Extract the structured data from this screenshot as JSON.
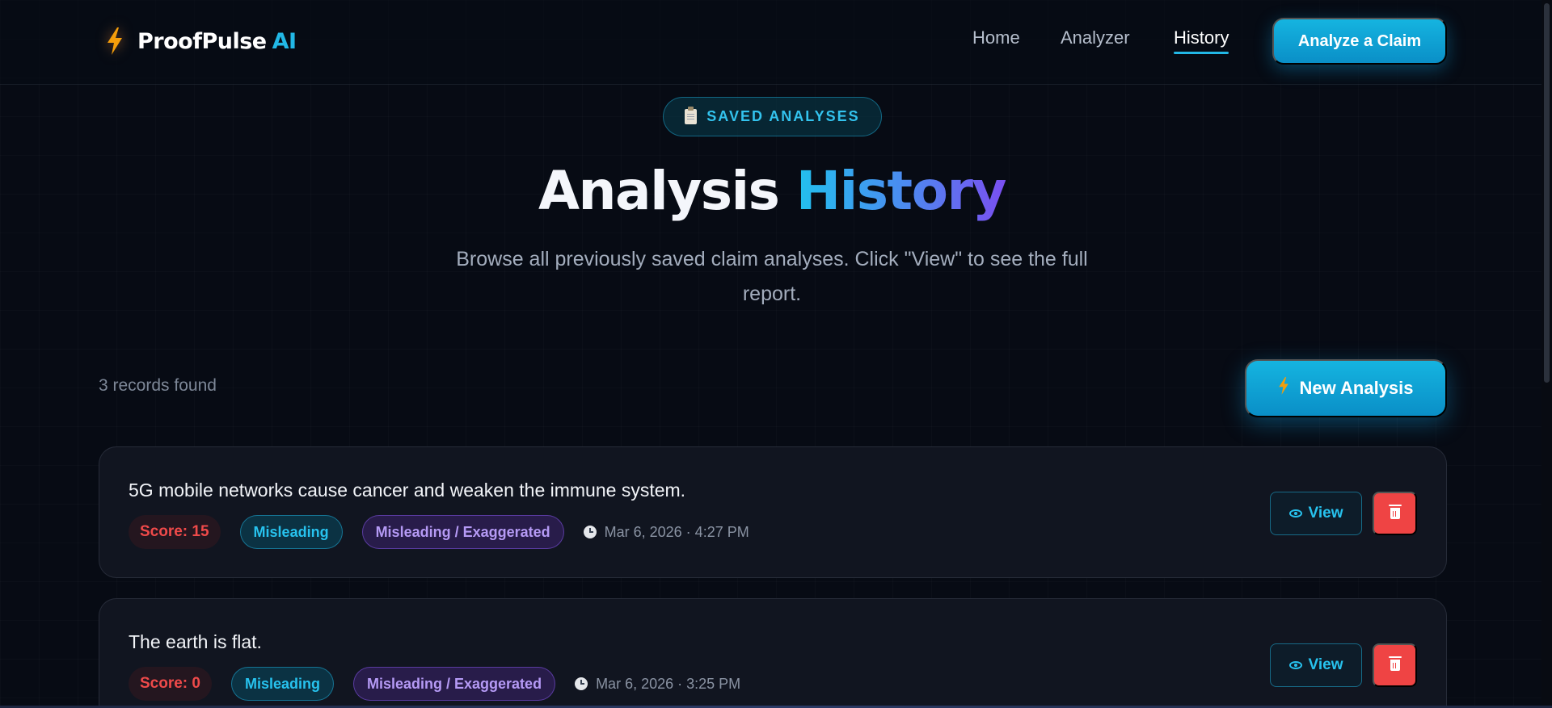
{
  "nav": {
    "brand_name": "ProofPulse",
    "brand_ai": "AI",
    "links": [
      "Home",
      "Analyzer",
      "History"
    ],
    "active_link": "History",
    "cta_label": "Analyze a Claim"
  },
  "hero": {
    "pill_label": "SAVED ANALYSES",
    "title_main": "Analysis",
    "title_accent": "History",
    "subtitle": "Browse all previously saved claim analyses. Click \"View\" to see the full report."
  },
  "toolbar": {
    "records_count": "3 records found",
    "new_analysis_label": "New Analysis"
  },
  "records": [
    {
      "claim": "5G mobile networks cause cancer and weaken the immune system.",
      "score": "Score: 15",
      "verdict": "Misleading",
      "category": "Misleading / Exaggerated",
      "timestamp": "Mar 6, 2026 · 4:27 PM",
      "view_label": "View"
    },
    {
      "claim": "The earth is flat.",
      "score": "Score: 0",
      "verdict": "Misleading",
      "category": "Misleading / Exaggerated",
      "timestamp": "Mar 6, 2026 · 3:25 PM",
      "view_label": "View"
    }
  ],
  "colors": {
    "background": "#070b14",
    "accent_cyan": "#22b8e6",
    "accent_purple": "#7a4ff0",
    "danger": "#ef4444",
    "brand_bolt": "#f59e0b"
  },
  "icons": {
    "brand": "lightning-bolt-icon",
    "pill": "clipboard-icon",
    "new_analysis": "lightning-bolt-icon",
    "timestamp": "clock-icon",
    "view": "eye-icon",
    "delete": "trash-icon"
  }
}
